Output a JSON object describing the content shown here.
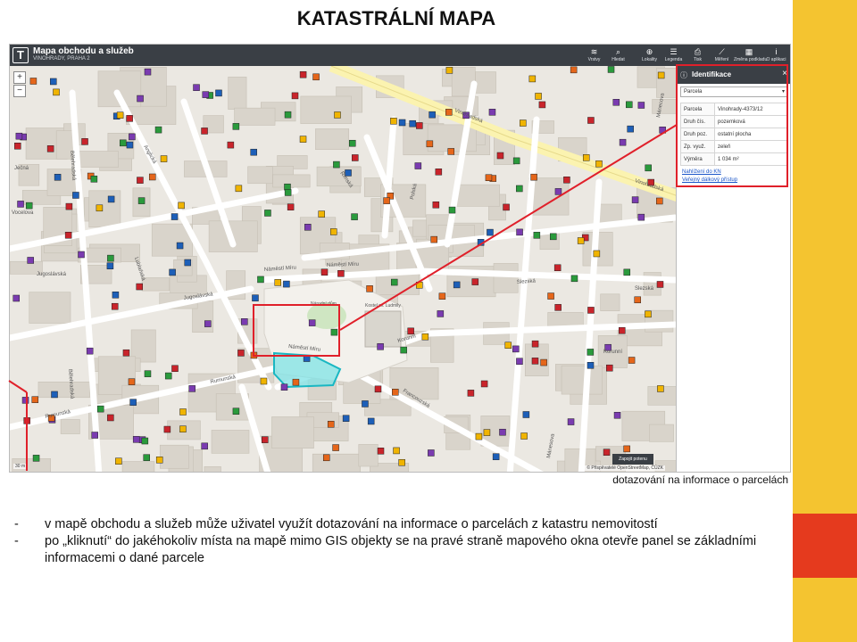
{
  "slide": {
    "title": "KATASTRÁLNÍ MAPA",
    "caption": "dotazování na informace o parcelách",
    "bullets": [
      "v mapě obchodu a služeb může uživatel využít dotazování na informace o parcelách z katastru nemovitostí",
      "po „kliknutí“ do jakéhokoliv místa na mapě mimo GIS objekty se na pravé straně mapového okna otevře panel se základními informacemi o dané parcele"
    ],
    "bullet_marker": "-",
    "side_colors": [
      "#f4c430",
      "#e53a1e",
      "#f4c430"
    ]
  },
  "app": {
    "logo": "T",
    "title": "Mapa obchodu a služeb",
    "subtitle": "VINOHRADY, PRAHA 2",
    "toolbar": [
      {
        "icon": "layers-icon",
        "glyph": "≋",
        "label": "Vrstvy"
      },
      {
        "icon": "search-icon",
        "glyph": "⌕",
        "label": "Hledat"
      },
      {
        "icon": "locate-icon",
        "glyph": "⊕",
        "label": "Lokality"
      },
      {
        "icon": "legend-icon",
        "glyph": "☰",
        "label": "Legenda"
      },
      {
        "icon": "print-icon",
        "glyph": "⎙",
        "label": "Tisk"
      },
      {
        "icon": "measure-icon",
        "glyph": "⟋",
        "label": "Měření"
      },
      {
        "icon": "basemap-icon",
        "glyph": "▦",
        "label": "Změna podkladu"
      },
      {
        "icon": "info-icon",
        "glyph": "i",
        "label": "O aplikaci"
      }
    ],
    "zoom_in": "+",
    "zoom_out": "−",
    "scale": "30 m",
    "attribution": "© Přispěvatelé OpenStreetMap, ČÚZK",
    "report_button": "Zapojit potenu"
  },
  "map": {
    "streets": [
      {
        "name": "Vinohradská"
      },
      {
        "name": "Vinohradská"
      },
      {
        "name": "Polská"
      },
      {
        "name": "Slezská"
      },
      {
        "name": "Slezská"
      },
      {
        "name": "Rumunská"
      },
      {
        "name": "Rumunská"
      },
      {
        "name": "Náměstí Míru"
      },
      {
        "name": "Náměstí Míru"
      },
      {
        "name": "Náměstí Míru"
      },
      {
        "name": "Jugoslávská"
      },
      {
        "name": "Jugoslávská"
      },
      {
        "name": "Bělehradská"
      },
      {
        "name": "Bělehradská"
      },
      {
        "name": "Anglická"
      },
      {
        "name": "Korunní"
      },
      {
        "name": "Korunní"
      },
      {
        "name": "Francouzská"
      },
      {
        "name": "Římská"
      },
      {
        "name": "Máneсova"
      },
      {
        "name": "Vocelova"
      },
      {
        "name": "Lublaňská"
      },
      {
        "name": "Ječná"
      },
      {
        "name": "Mánesova"
      }
    ],
    "places": [
      {
        "name": "Národní dům"
      },
      {
        "name": "Kostel sv. Ludmily"
      }
    ]
  },
  "panel": {
    "title": "Identifikace",
    "select_value": "Parcela",
    "rows": [
      {
        "key": "Parcela",
        "value": "Vinohrady-4373/12"
      },
      {
        "key": "Druh čís.",
        "value": "pozemková"
      },
      {
        "key": "Druh poz.",
        "value": "ostatní plocha"
      },
      {
        "key": "Zp. využ.",
        "value": "zeleň"
      },
      {
        "key": "Výměra",
        "value": "1 034 m²"
      }
    ],
    "links": [
      "Nahlížení do KN",
      "Veřejný dálkový přístup"
    ]
  }
}
